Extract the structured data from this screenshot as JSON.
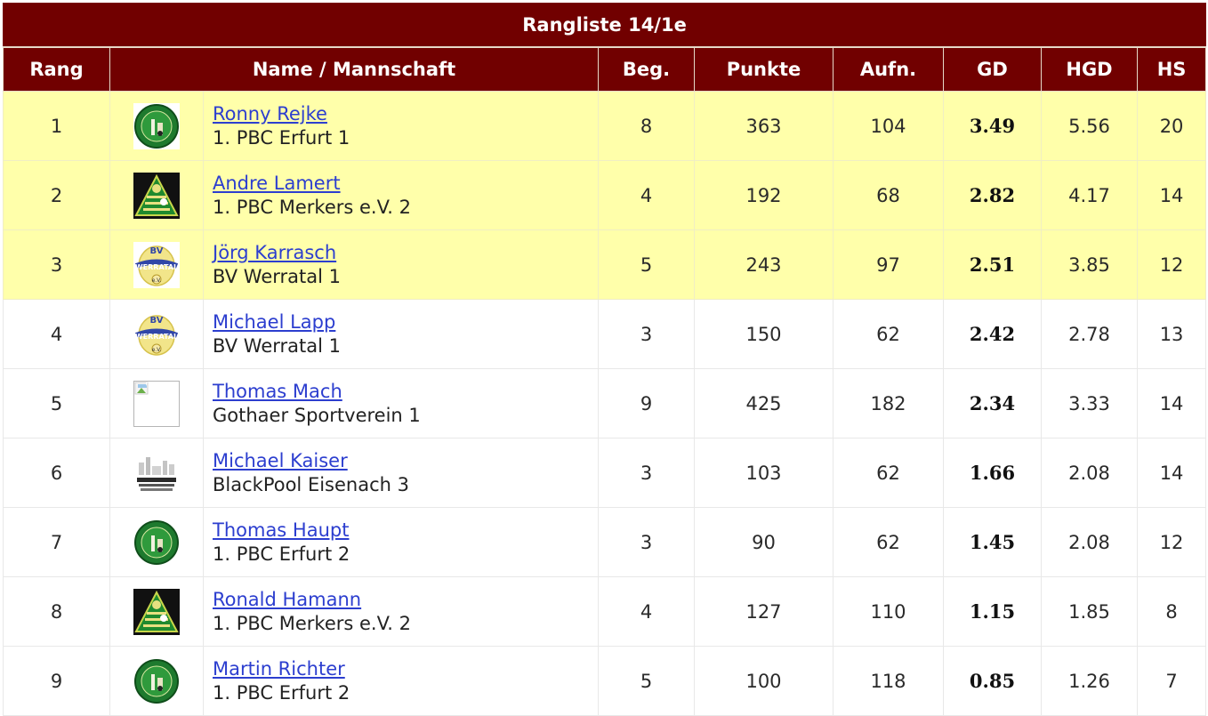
{
  "title": "Rangliste 14/1e",
  "headers": [
    "Rang",
    "Name / Mannschaft",
    "Beg.",
    "Punkte",
    "Aufn.",
    "GD",
    "HGD",
    "HS"
  ],
  "rows": [
    {
      "rank": "1",
      "name": "Ronny Rejke",
      "team": "1. PBC Erfurt 1",
      "beg": "8",
      "punkte": "363",
      "aufn": "104",
      "gd": "3.49",
      "hgd": "5.56",
      "hs": "20",
      "logo": "pbc-erfurt-logo"
    },
    {
      "rank": "2",
      "name": "Andre Lamert",
      "team": "1. PBC Merkers e.V. 2",
      "beg": "4",
      "punkte": "192",
      "aufn": "68",
      "gd": "2.82",
      "hgd": "4.17",
      "hs": "14",
      "logo": "pbc-merkers-logo"
    },
    {
      "rank": "3",
      "name": "Jörg Karrasch",
      "team": "BV Werratal 1",
      "beg": "5",
      "punkte": "243",
      "aufn": "97",
      "gd": "2.51",
      "hgd": "3.85",
      "hs": "12",
      "logo": "bv-werratal-logo"
    },
    {
      "rank": "4",
      "name": "Michael Lapp",
      "team": "BV Werratal 1",
      "beg": "3",
      "punkte": "150",
      "aufn": "62",
      "gd": "2.42",
      "hgd": "2.78",
      "hs": "13",
      "logo": "bv-werratal-logo"
    },
    {
      "rank": "5",
      "name": "Thomas Mach",
      "team": "Gothaer Sportverein 1",
      "beg": "9",
      "punkte": "425",
      "aufn": "182",
      "gd": "2.34",
      "hgd": "3.33",
      "hs": "14",
      "logo": "broken-image-icon"
    },
    {
      "rank": "6",
      "name": "Michael Kaiser",
      "team": "BlackPool Eisenach 3",
      "beg": "3",
      "punkte": "103",
      "aufn": "62",
      "gd": "1.66",
      "hgd": "2.08",
      "hs": "14",
      "logo": "blackpool-logo"
    },
    {
      "rank": "7",
      "name": "Thomas Haupt",
      "team": "1. PBC Erfurt 2",
      "beg": "3",
      "punkte": "90",
      "aufn": "62",
      "gd": "1.45",
      "hgd": "2.08",
      "hs": "12",
      "logo": "pbc-erfurt-logo"
    },
    {
      "rank": "8",
      "name": "Ronald Hamann",
      "team": "1. PBC Merkers e.V. 2",
      "beg": "4",
      "punkte": "127",
      "aufn": "110",
      "gd": "1.15",
      "hgd": "1.85",
      "hs": "8",
      "logo": "pbc-merkers-logo"
    },
    {
      "rank": "9",
      "name": "Martin Richter",
      "team": "1. PBC Erfurt 2",
      "beg": "5",
      "punkte": "100",
      "aufn": "118",
      "gd": "0.85",
      "hgd": "1.26",
      "hs": "7",
      "logo": "pbc-erfurt-logo"
    }
  ],
  "colors": {
    "header_bg": "#710000",
    "highlight_bg": "#ffffaa",
    "link": "#2c3ecf"
  }
}
